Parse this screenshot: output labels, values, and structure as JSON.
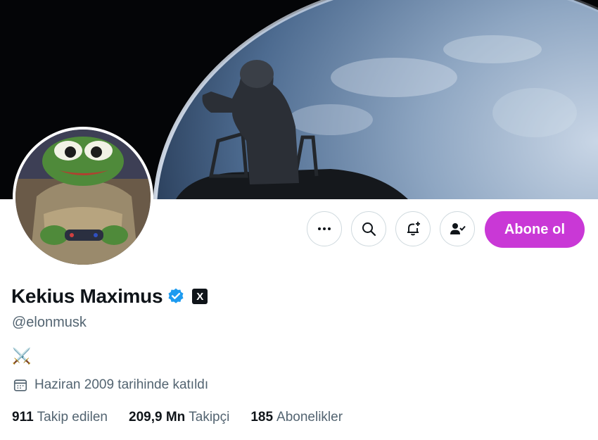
{
  "profile": {
    "display_name": "Kekius Maximus",
    "handle": "@elonmusk",
    "bio": "⚔️",
    "joined": "Haziran 2009 tarihinde katıldı",
    "verified_color": "#1d9bf0"
  },
  "actions": {
    "more_icon": "more-icon",
    "search_icon": "search-icon",
    "notify_icon": "bell-plus-icon",
    "following_icon": "person-check-icon",
    "subscribe_label": "Abone ol",
    "subscribe_color": "#c938d6"
  },
  "stats": {
    "following_count": "911",
    "following_label": "Takip edilen",
    "followers_count": "209,9 Mn",
    "followers_label": "Takipçi",
    "subscriptions_count": "185",
    "subscriptions_label": "Abonelikler"
  },
  "badges": {
    "x_badge": "X"
  }
}
